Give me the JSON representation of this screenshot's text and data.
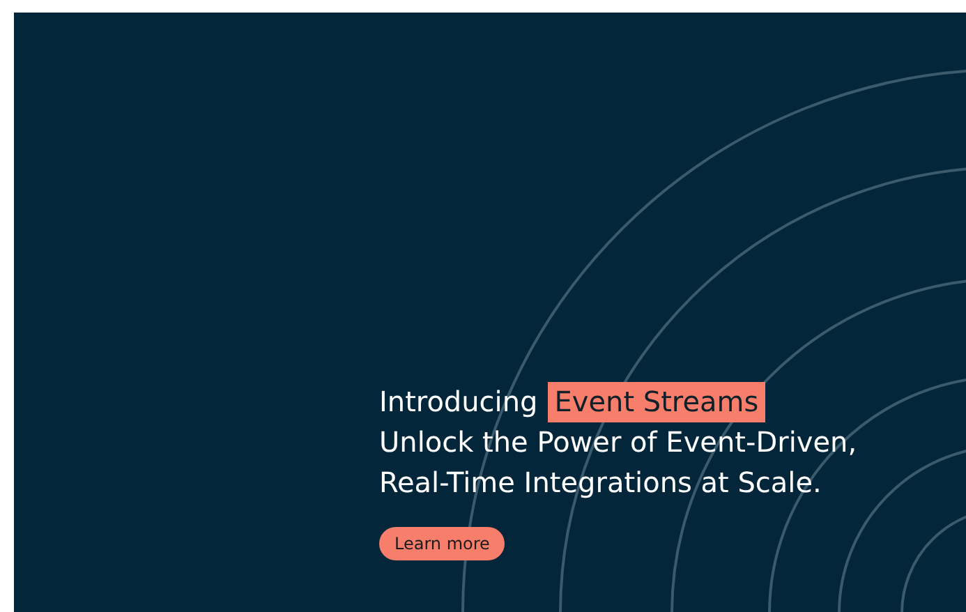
{
  "hero": {
    "headline": {
      "lead": "Introducing",
      "highlight": "Event Streams"
    },
    "subtitle": "Unlock the Power of Event-Driven, Real-Time Integrations at Scale.",
    "button": "Learn more"
  }
}
